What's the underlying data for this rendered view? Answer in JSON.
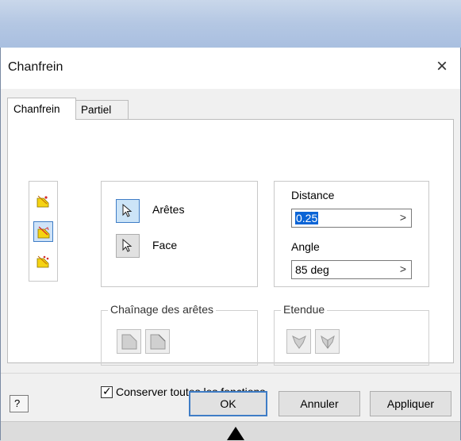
{
  "window": {
    "title": "Chanfrein",
    "close_glyph": "×"
  },
  "tabs": [
    {
      "label": "Chanfrein",
      "active": true
    },
    {
      "label": "Partiel",
      "active": false
    }
  ],
  "mode_buttons": [
    {
      "icon": "chamfer-distance-icon",
      "selected": false
    },
    {
      "icon": "chamfer-distance-angle-icon",
      "selected": true
    },
    {
      "icon": "chamfer-two-distances-icon",
      "selected": false
    }
  ],
  "selection": {
    "edges_label": "Arêtes",
    "face_label": "Face"
  },
  "fields": {
    "distance_label": "Distance",
    "distance_value": "0.25",
    "angle_label": "Angle",
    "angle_value": "85 deg",
    "arrow_glyph": ">"
  },
  "chain": {
    "title": "Chaînage des arêtes"
  },
  "extent": {
    "title": "Etendue"
  },
  "option": {
    "label": "Conserver toutes les fonctions",
    "checked": true,
    "check_glyph": "✓"
  },
  "footer": {
    "help_glyph": "?",
    "ok_label": "OK",
    "cancel_label": "Annuler",
    "apply_label": "Appliquer"
  },
  "colors": {
    "accent": "#3f7dc6",
    "selection_highlight": "#0a64d6",
    "icon_yellow": "#f5d312",
    "icon_red": "#d62a2a"
  }
}
